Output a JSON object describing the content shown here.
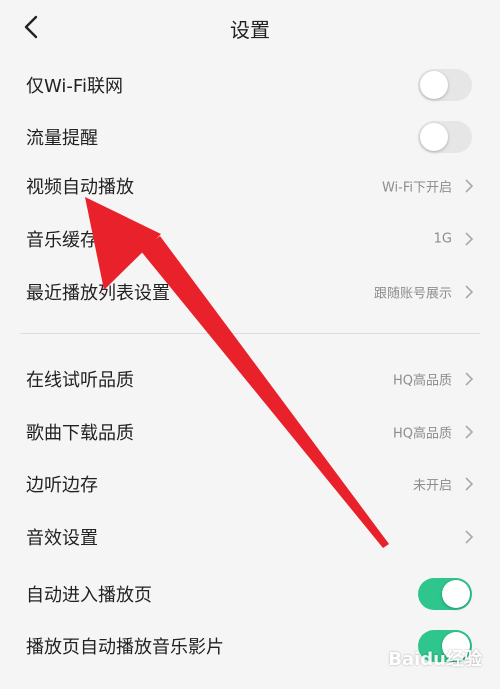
{
  "header": {
    "title": "设置",
    "back_icon": "chevron-left-icon"
  },
  "section1": [
    {
      "label": "仅Wi-Fi联网",
      "toggle": false
    },
    {
      "label": "流量提醒",
      "toggle": false
    },
    {
      "label": "视频自动播放",
      "value": "Wi-Fi下开启"
    },
    {
      "label": "音乐缓存",
      "value": "1G"
    },
    {
      "label": "最近播放列表设置",
      "value": "跟随账号展示"
    }
  ],
  "section2": [
    {
      "label": "在线试听品质",
      "value": "HQ高品质"
    },
    {
      "label": "歌曲下载品质",
      "value": "HQ高品质"
    },
    {
      "label": "边听边存",
      "value": "未开启"
    },
    {
      "label": "音效设置",
      "value": ""
    },
    {
      "label": "自动进入播放页",
      "toggle": true
    },
    {
      "label": "播放页自动播放音乐影片",
      "toggle": true
    }
  ],
  "colors": {
    "toggle_on": "#2ec68c",
    "toggle_off": "#e6e6e6",
    "annotation_arrow": "#e8212b"
  },
  "watermark": "Baidu经验"
}
